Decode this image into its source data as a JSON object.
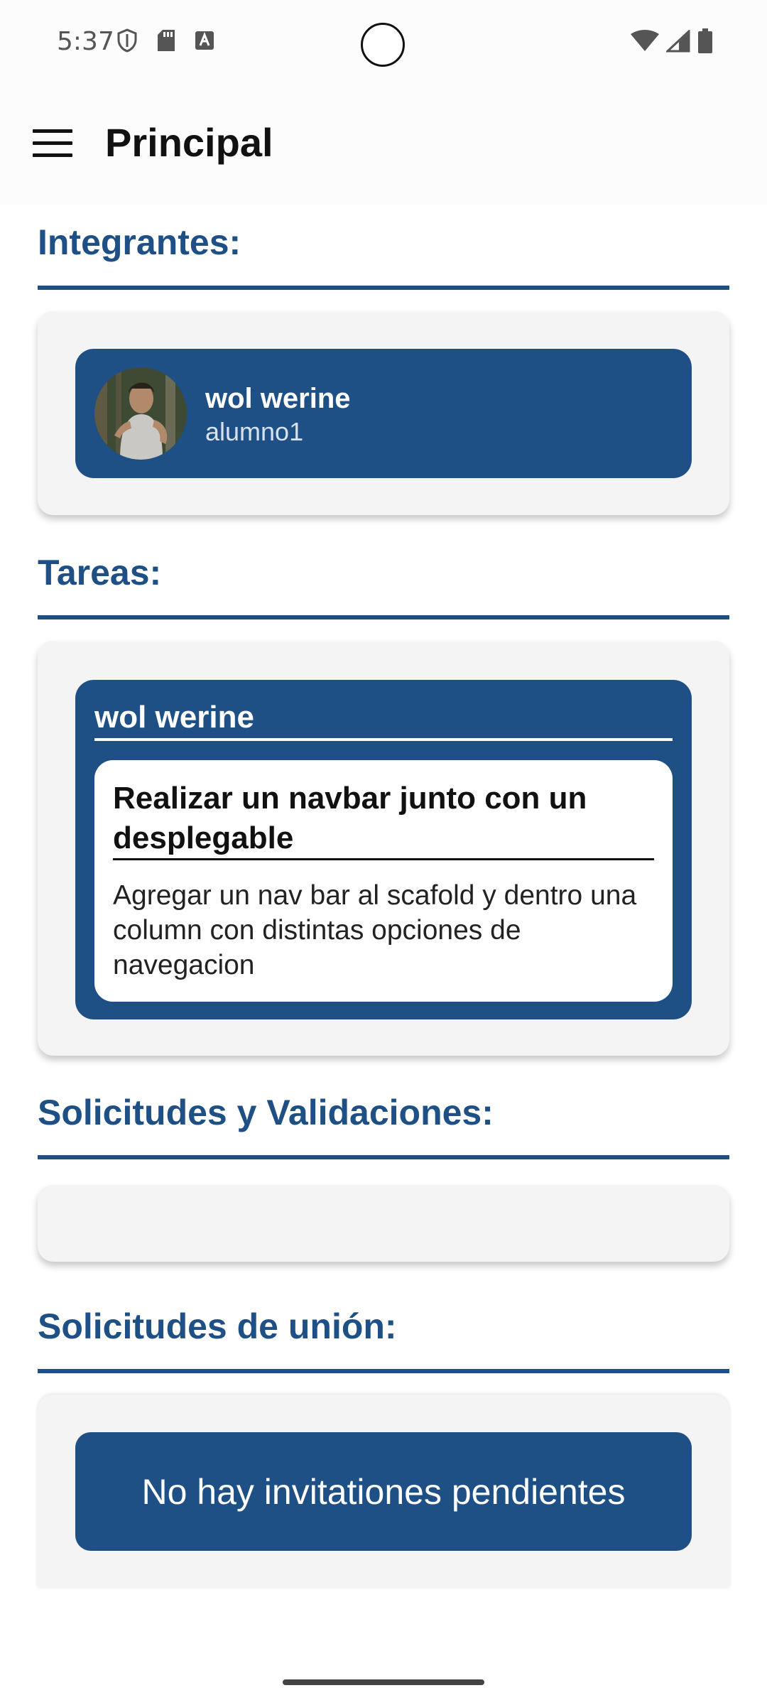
{
  "status_bar": {
    "time": "5:37",
    "left_icons": [
      "shield-icon",
      "sd-card-icon",
      "font-a-icon"
    ],
    "right_icons": [
      "wifi-icon",
      "signal-icon",
      "battery-icon"
    ]
  },
  "app_bar": {
    "menu_icon": "menu-icon",
    "title": "Principal"
  },
  "sections": {
    "members": {
      "title": "Integrantes:",
      "items": [
        {
          "name": "wol werine",
          "username": "alumno1",
          "avatar": "user-photo"
        }
      ]
    },
    "tasks": {
      "title": "Tareas:",
      "items": [
        {
          "owner": "wol werine",
          "task_title": "Realizar un navbar junto con un desplegable",
          "task_description": "Agregar un nav bar al scafold y dentro una column con distintas opciones de navegacion"
        }
      ]
    },
    "requests": {
      "title": "Solicitudes y Validaciones:"
    },
    "join_requests": {
      "title": "Solicitudes de unión:",
      "empty_message": "No hay invitationes pendientes"
    }
  },
  "colors": {
    "primary": "#1e4f85",
    "panel_background": "#f4f4f4",
    "app_bar_background": "#fcfcfc"
  }
}
